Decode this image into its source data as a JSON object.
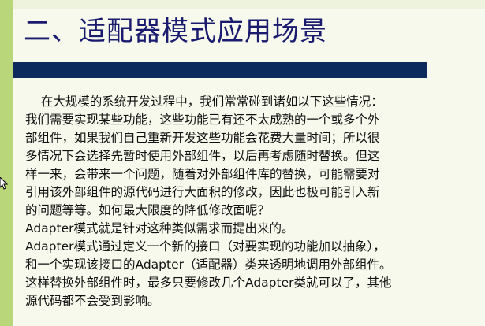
{
  "slide": {
    "title": "二、适配器模式应用场景",
    "lines": [
      "    在大规模的系统开发过程中，我们常常碰到诸如以下这些情况：",
      "我们需要实现某些功能，这些功能已有还不太成熟的一个或多个外",
      "部组件，如果我们自己重新开发这些功能会花费大量时间；所以很",
      "多情况下会选择先暂时使用外部组件，以后再考虑随时替换。但这",
      "样一来，会带来一个问题，随着对外部组件库的替换，可能需要对",
      "引用该外部组件的源代码进行大面积的修改，因此也极可能引入新",
      "的问题等等。如何最大限度的降低修改面呢？",
      "Adapter模式就是针对这种类似需求而提出来的。",
      "Adapter模式通过定义一个新的接口（对要实现的功能加以抽象），",
      "和一个实现该接口的Adapter（适配器）类来透明地调用外部组件。",
      "这样替换外部组件时，最多只要修改几个Adapter类就可以了，其他",
      "源代码都不会受到影响。"
    ]
  },
  "colors": {
    "title": "#1a1a6e",
    "bar": "#0c2a5c",
    "strip": "#b9d77a",
    "background": "#f6f9ec"
  }
}
